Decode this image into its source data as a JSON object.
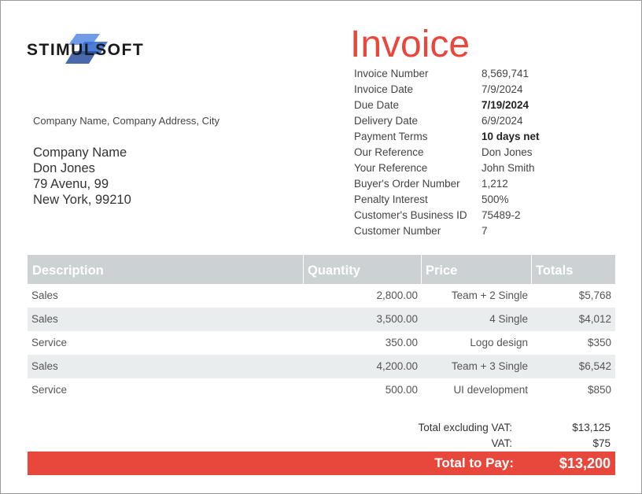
{
  "brand": {
    "logo_text": "STIMULSOFT",
    "logo_colors": [
      "#3a6fd1",
      "#2a4f9e",
      "#6f9be8"
    ]
  },
  "title": "Invoice",
  "accent_color": "#e8473b",
  "details": [
    {
      "label": "Invoice Number",
      "value": "8,569,741",
      "bold": false
    },
    {
      "label": "Invoice Date",
      "value": "7/9/2024",
      "bold": false
    },
    {
      "label": "Due Date",
      "value": "7/19/2024",
      "bold": true
    },
    {
      "label": "Delivery Date",
      "value": "6/9/2024",
      "bold": false
    },
    {
      "label": "Payment Terms",
      "value": "10 days net",
      "bold": true
    },
    {
      "label": "Our Reference",
      "value": "Don Jones",
      "bold": false
    },
    {
      "label": "Your Reference",
      "value": "John Smith",
      "bold": false
    },
    {
      "label": "Buyer's Order Number",
      "value": "1,212",
      "bold": false
    },
    {
      "label": "Penalty Interest",
      "value": "500%",
      "bold": false
    },
    {
      "label": "Customer's Business ID",
      "value": "75489-2",
      "bold": false
    },
    {
      "label": "Customer Number",
      "value": "7",
      "bold": false
    }
  ],
  "sender_line": "Company Name, Company Address, City",
  "buyer": {
    "company": "Company Name",
    "contact": "Don Jones",
    "street": "79 Avenu, 99",
    "city": "New York, 99210"
  },
  "table": {
    "headers": {
      "description": "Description",
      "quantity": "Quantity",
      "price": "Price",
      "totals": "Totals"
    },
    "rows": [
      {
        "description": "Sales",
        "quantity": "2,800.00",
        "price": "Team + 2 Single",
        "total": "$5,768"
      },
      {
        "description": "Sales",
        "quantity": "3,500.00",
        "price": "4 Single",
        "total": "$4,012"
      },
      {
        "description": "Service",
        "quantity": "350.00",
        "price": "Logo design",
        "total": "$350"
      },
      {
        "description": "Sales",
        "quantity": "4,200.00",
        "price": "Team + 3 Single",
        "total": "$6,542"
      },
      {
        "description": "Service",
        "quantity": "500.00",
        "price": "UI development",
        "total": "$850"
      }
    ]
  },
  "summary": {
    "excl_vat_label": "Total excluding VAT:",
    "excl_vat_value": "$13,125",
    "vat_label": "VAT:",
    "vat_value": "$75",
    "total_label": "Total to Pay:",
    "total_value": "$13,200"
  }
}
